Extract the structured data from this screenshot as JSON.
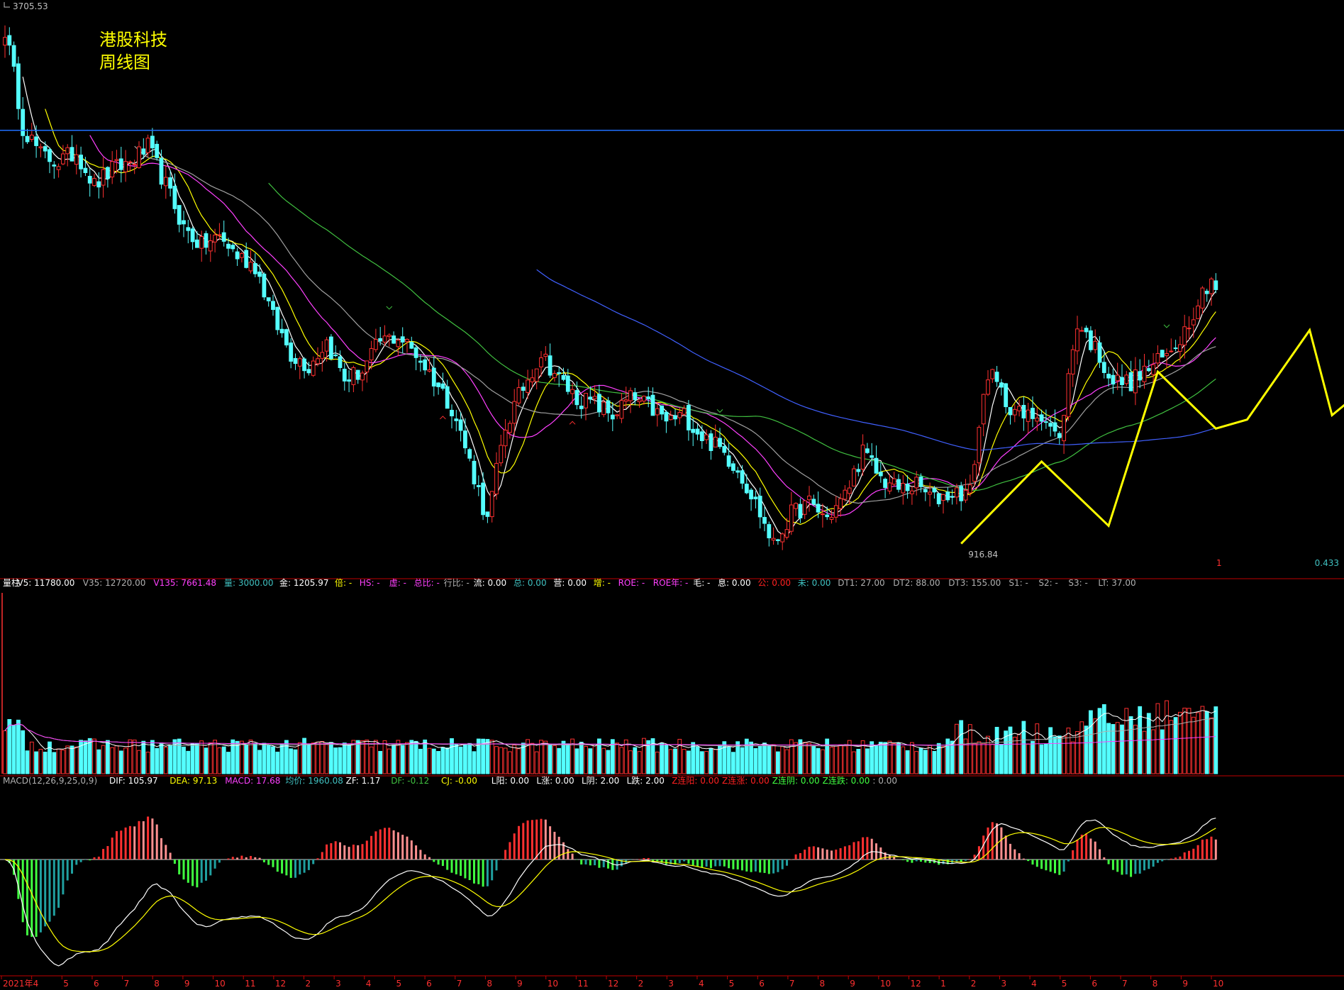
{
  "title": {
    "line1": "港股科技",
    "line2": "周线图"
  },
  "price_panel": {
    "high_label": "3705.53",
    "low_label": "916.84",
    "right_value": "0.433",
    "right_mark": "1"
  },
  "volume_legend": [
    {
      "text": "量柱",
      "color": "#ffffff"
    },
    {
      "text": "V5: 11780.00",
      "color": "#ffffff"
    },
    {
      "text": "V35: 12720.00",
      "color": "#b0b0b0"
    },
    {
      "text": "V135: 7661.48",
      "color": "#ff40ff"
    },
    {
      "text": "量: 3000.00",
      "color": "#40c0c0"
    },
    {
      "text": "金: 1205.97",
      "color": "#ffffff"
    },
    {
      "text": "倍: -",
      "color": "#ffff00"
    },
    {
      "text": "HS: -",
      "color": "#ff40ff"
    },
    {
      "text": "虚: -",
      "color": "#ff40ff"
    },
    {
      "text": "总比: -",
      "color": "#ff40ff"
    },
    {
      "text": "行比: -",
      "color": "#b0b0b0"
    },
    {
      "text": "流: 0.00",
      "color": "#ffffff"
    },
    {
      "text": "总: 0.00",
      "color": "#40c0c0"
    },
    {
      "text": "营: 0.00",
      "color": "#ffffff"
    },
    {
      "text": "增: -",
      "color": "#ffff00"
    },
    {
      "text": "ROE: -",
      "color": "#ff40ff"
    },
    {
      "text": "ROE年: -",
      "color": "#ff40ff"
    },
    {
      "text": "毛: -",
      "color": "#ffffff"
    },
    {
      "text": "息: 0.00",
      "color": "#ffffff"
    },
    {
      "text": "公: 0.00",
      "color": "#ff2020"
    },
    {
      "text": "未: 0.00",
      "color": "#40c0c0"
    },
    {
      "text": "DT1: 27.00",
      "color": "#b0b0b0"
    },
    {
      "text": "DT2: 88.00",
      "color": "#b0b0b0"
    },
    {
      "text": "DT3: 155.00",
      "color": "#b0b0b0"
    },
    {
      "text": "S1: -",
      "color": "#b0b0b0"
    },
    {
      "text": "S2: -",
      "color": "#b0b0b0"
    },
    {
      "text": "S3: -",
      "color": "#b0b0b0"
    },
    {
      "text": "LT: 37.00",
      "color": "#b0b0b0"
    }
  ],
  "macd_legend": [
    {
      "text": "MACD(12,26,9,25,0,9)",
      "color": "#b0b0b0"
    },
    {
      "text": "DIF: 105.97",
      "color": "#ffffff"
    },
    {
      "text": "DEA: 97.13",
      "color": "#ffff00"
    },
    {
      "text": "MACD: 17.68",
      "color": "#ff40ff"
    },
    {
      "text": "均价: 1960.08",
      "color": "#40c0c0"
    },
    {
      "text": "ZF: 1.17",
      "color": "#ffffff"
    },
    {
      "text": "DF: -0.12",
      "color": "#40c040"
    },
    {
      "text": "CJ: -0.00",
      "color": "#ffff00"
    },
    {
      "text": "L阳: 0.00",
      "color": "#ffffff"
    },
    {
      "text": "L涨: 0.00",
      "color": "#ffffff"
    },
    {
      "text": "L阴: 2.00",
      "color": "#ffffff"
    },
    {
      "text": "L跌: 2.00",
      "color": "#ffffff"
    },
    {
      "text": "Z连阳: 0.00",
      "color": "#ff2020"
    },
    {
      "text": "Z连涨: 0.00",
      "color": "#ff2020"
    },
    {
      "text": "Z连阴: 0.00",
      "color": "#40ff40"
    },
    {
      "text": "Z连跌: 0.00",
      "color": "#40ff40"
    },
    {
      "text": ": 0.00",
      "color": "#b0b0b0"
    }
  ],
  "x_axis_labels": [
    "2021年",
    "4",
    "5",
    "6",
    "7",
    "8",
    "9",
    "10",
    "11",
    "12",
    "2",
    "3",
    "4",
    "5",
    "6",
    "7",
    "8",
    "9",
    "10",
    "11",
    "12",
    "2",
    "3",
    "4",
    "5",
    "6",
    "7",
    "8",
    "9",
    "10",
    "12",
    "1",
    "2",
    "3",
    "4",
    "5",
    "6",
    "7",
    "8",
    "9",
    "10"
  ],
  "colors": {
    "up": "#ff3030",
    "down": "#54ffff",
    "ma5": "#ffffff",
    "ma10": "#ffff00",
    "ma20": "#ff40ff",
    "ma30": "#a0a0a0",
    "ma60": "#40c040",
    "ma120": "#4060ff",
    "hline": "#2070ff",
    "zigzag": "#ffff00",
    "axis": "#c00000"
  },
  "chart_data": [
    {
      "type": "candlestick",
      "title": "港股科技 周线图",
      "ylim": [
        916.84,
        3705.53
      ],
      "high": 3705.53,
      "low": 916.84,
      "horizontal_line": 2770,
      "close_path": [
        [
          0,
          3600
        ],
        [
          4,
          2800
        ],
        [
          8,
          2600
        ],
        [
          12,
          2550
        ],
        [
          16,
          2620
        ],
        [
          20,
          2400
        ],
        [
          24,
          2500
        ],
        [
          28,
          2550
        ],
        [
          32,
          2650
        ],
        [
          36,
          2400
        ],
        [
          40,
          2150
        ],
        [
          44,
          2050
        ],
        [
          48,
          2100
        ],
        [
          52,
          2000
        ],
        [
          56,
          1950
        ],
        [
          60,
          1700
        ],
        [
          64,
          1550
        ],
        [
          68,
          1500
        ],
        [
          72,
          1600
        ],
        [
          76,
          1450
        ],
        [
          80,
          1480
        ],
        [
          84,
          1600
        ],
        [
          88,
          1620
        ],
        [
          92,
          1550
        ],
        [
          96,
          1450
        ],
        [
          100,
          1350
        ],
        [
          104,
          1170
        ],
        [
          108,
          1000
        ],
        [
          112,
          1280
        ],
        [
          116,
          1420
        ],
        [
          120,
          1550
        ],
        [
          124,
          1450
        ],
        [
          128,
          1380
        ],
        [
          132,
          1360
        ],
        [
          136,
          1320
        ],
        [
          140,
          1380
        ],
        [
          144,
          1350
        ],
        [
          148,
          1300
        ],
        [
          152,
          1320
        ],
        [
          156,
          1250
        ],
        [
          160,
          1210
        ],
        [
          164,
          1150
        ],
        [
          168,
          1050
        ],
        [
          172,
          940
        ],
        [
          176,
          1020
        ],
        [
          180,
          1050
        ],
        [
          184,
          1010
        ],
        [
          188,
          1070
        ],
        [
          192,
          1200
        ],
        [
          196,
          1120
        ],
        [
          200,
          1090
        ],
        [
          204,
          1100
        ],
        [
          208,
          1060
        ],
        [
          212,
          1080
        ],
        [
          216,
          1080
        ],
        [
          220,
          1480
        ],
        [
          224,
          1370
        ],
        [
          228,
          1310
        ],
        [
          232,
          1330
        ],
        [
          236,
          1230
        ],
        [
          240,
          1680
        ],
        [
          244,
          1570
        ],
        [
          248,
          1440
        ],
        [
          252,
          1440
        ],
        [
          256,
          1490
        ],
        [
          260,
          1540
        ],
        [
          264,
          1650
        ],
        [
          268,
          1820
        ],
        [
          270,
          1890
        ],
        [
          272,
          1780
        ]
      ],
      "zigzag": [
        [
          214,
          945
        ],
        [
          232,
          1170
        ],
        [
          247,
          990
        ],
        [
          258,
          1478
        ],
        [
          271,
          1275
        ],
        [
          278,
          1305
        ],
        [
          292,
          1647
        ],
        [
          297,
          1320
        ],
        [
          327,
          1760
        ]
      ],
      "markers": [
        {
          "i": 86,
          "type": "high"
        },
        {
          "i": 98,
          "type": "low"
        },
        {
          "i": 127,
          "type": "low"
        },
        {
          "i": 160,
          "type": "high"
        },
        {
          "i": 260,
          "type": "high"
        }
      ]
    },
    {
      "type": "bar",
      "title": "量柱",
      "V5": 11780.0,
      "V35": 12720.0,
      "V135": 7661.48
    },
    {
      "type": "macd",
      "title": "MACD(12,26,9,25,0,9)",
      "DIF": 105.97,
      "DEA": 97.13,
      "MACD": 17.68
    }
  ]
}
